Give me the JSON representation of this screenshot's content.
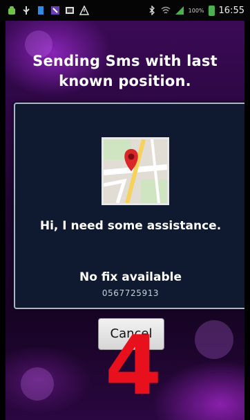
{
  "status_bar": {
    "battery_percent": "100%",
    "time": "16:55",
    "icons": [
      "android-icon",
      "usb-icon",
      "notification-icon",
      "phone-icon",
      "gallery-icon",
      "warning-icon",
      "bluetooth-icon",
      "wifi-icon",
      "signal-icon",
      "battery-icon"
    ]
  },
  "screen": {
    "heading": "Sending Sms with last known position.",
    "dialog": {
      "map_icon": "map-marker-icon",
      "message": "Hi, I need some assistance.",
      "fix_status": "No fix available",
      "phone_number": "0567725913"
    },
    "cancel_label": "Cancel",
    "overlay_number": "4"
  },
  "colors": {
    "background": "#2a0740",
    "dialog_bg": "#0f1a30",
    "overlay_number": "#e8101c"
  }
}
